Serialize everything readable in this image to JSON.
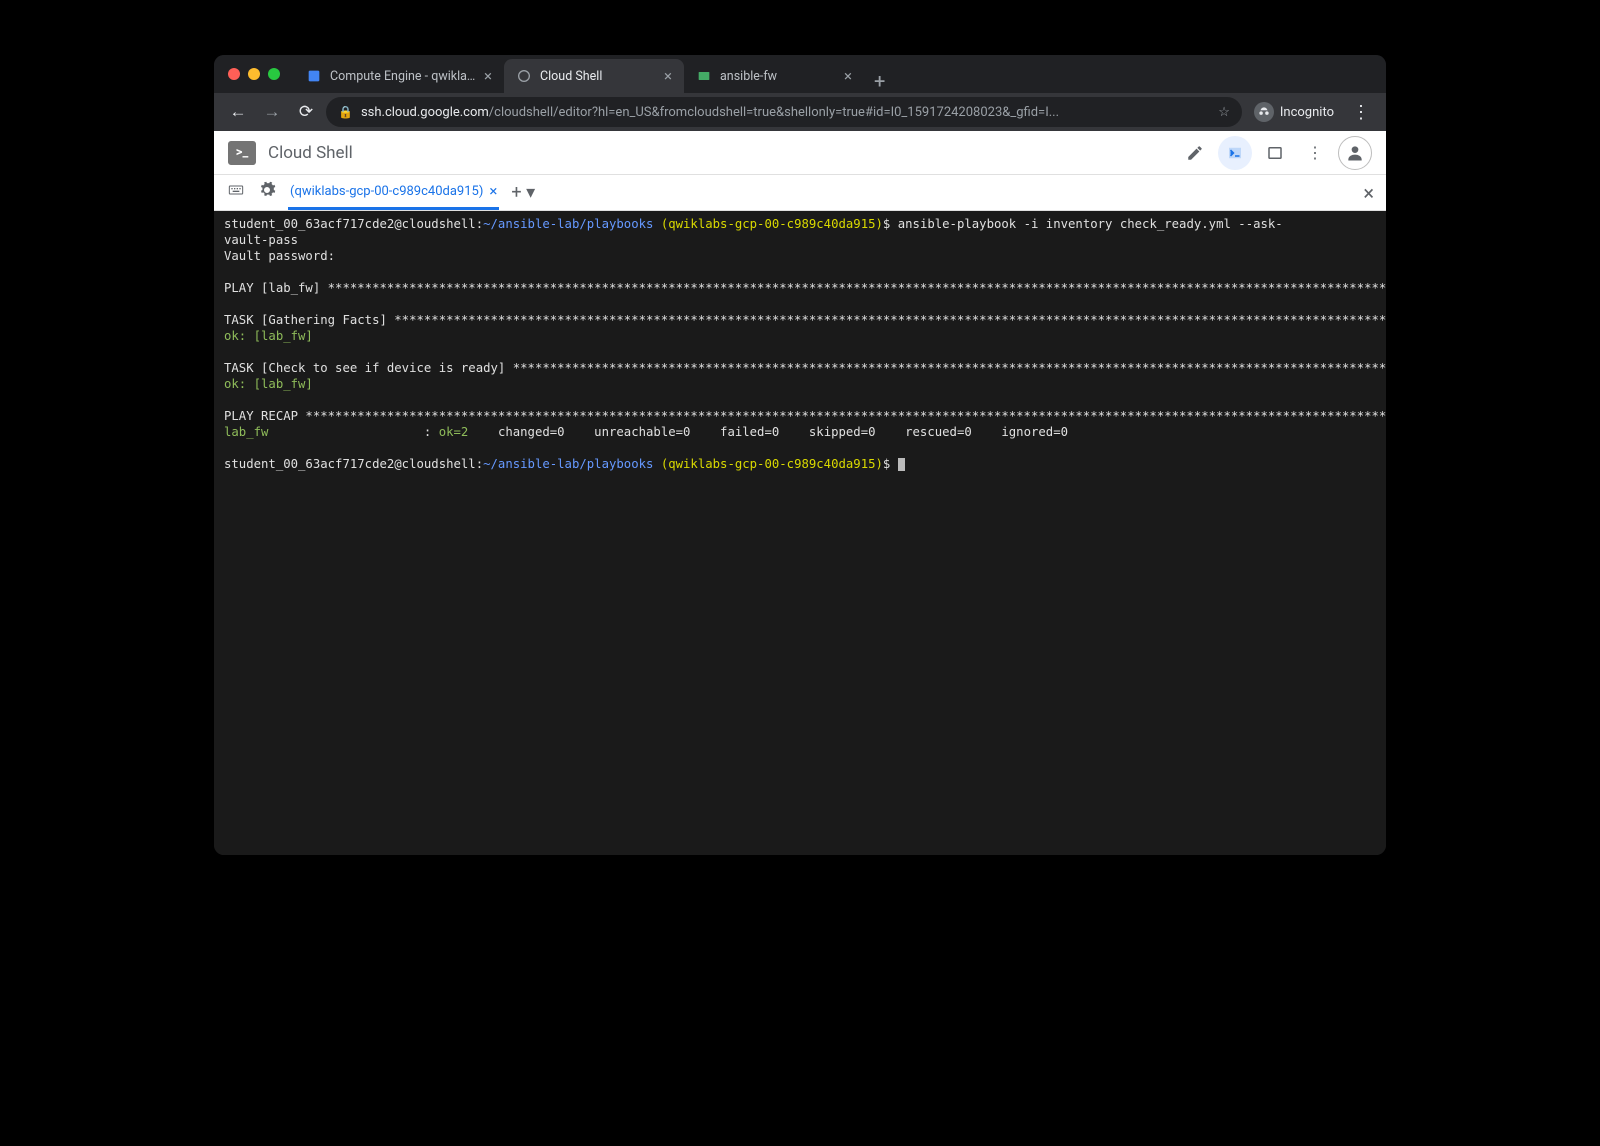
{
  "browser": {
    "tabs": [
      {
        "label": "Compute Engine - qwiklabs-gc",
        "active": false
      },
      {
        "label": "Cloud Shell",
        "active": true
      },
      {
        "label": "ansible-fw",
        "active": false
      }
    ],
    "url_host": "ssh.cloud.google.com",
    "url_path": "/cloudshell/editor?hl=en_US&fromcloudshell=true&shellonly=true#id=I0_1591724208023&_gfid=I...",
    "incognito_label": "Incognito"
  },
  "cloudshell": {
    "title": "Cloud Shell",
    "terminal_tab": "(qwiklabs-gcp-00-c989c40da915)"
  },
  "terminal": {
    "prompt_user": "student_00_63acf717cde2@cloudshell",
    "prompt_path": "~/ansible-lab/playbooks",
    "prompt_project": "(qwiklabs-gcp-00-c989c40da915)",
    "command": "ansible-playbook -i inventory check_ready.yml --ask-vault-pass",
    "vault_prompt": "Vault password:",
    "play_header": "PLAY [lab_fw] ",
    "task1_header": "TASK [Gathering Facts] ",
    "task1_result": "ok: [lab_fw]",
    "task2_header": "TASK [Check to see if device is ready] ",
    "task2_result": "ok: [lab_fw]",
    "recap_header": "PLAY RECAP ",
    "recap_host": "lab_fw",
    "recap_ok": "ok=2",
    "recap_stats": "    changed=0    unreachable=0    failed=0    skipped=0    rescued=0    ignored=0"
  }
}
